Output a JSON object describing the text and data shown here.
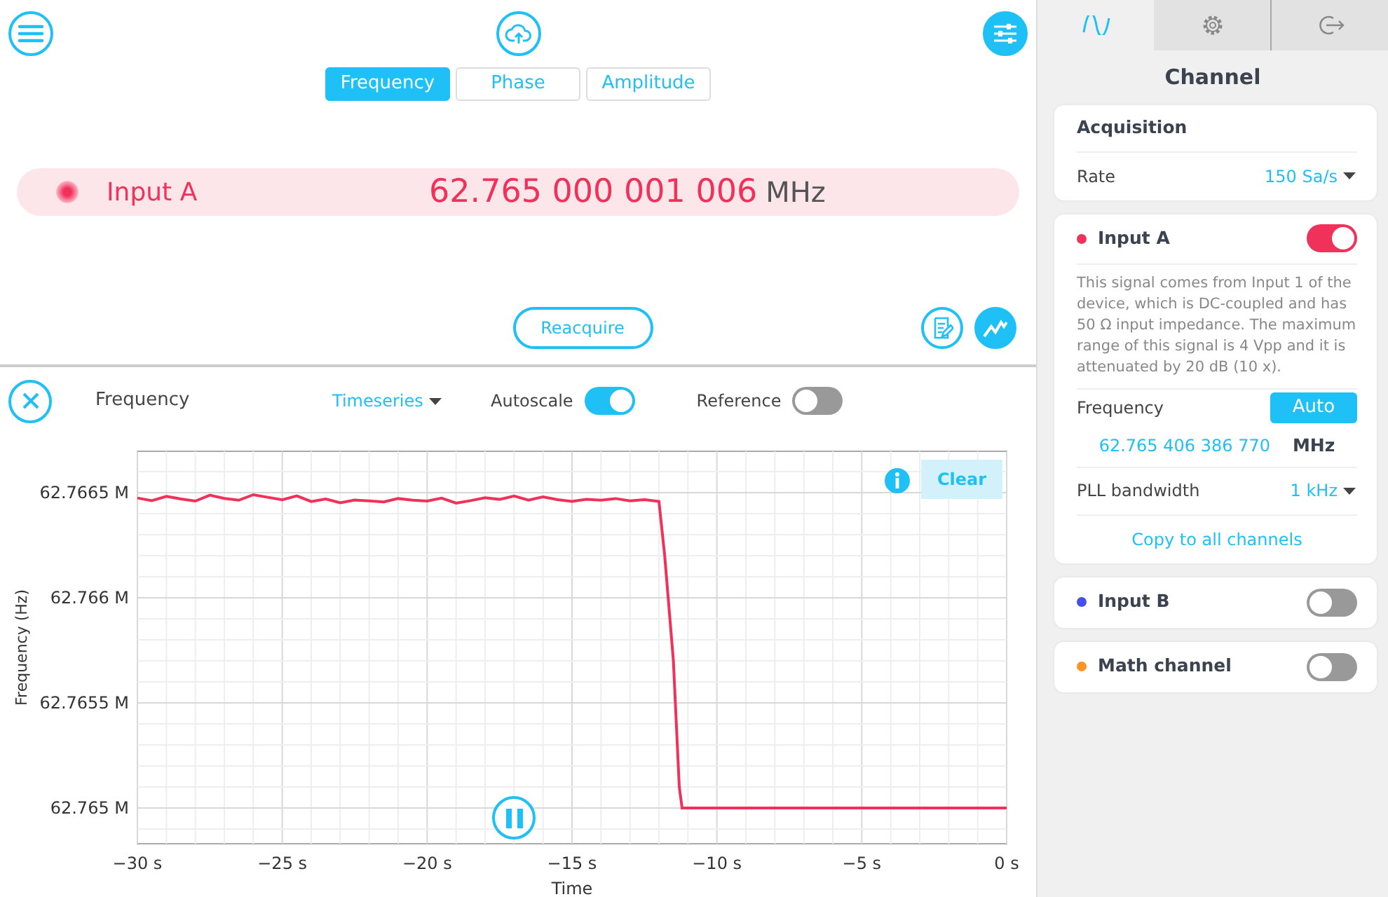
{
  "view_tabs": [
    {
      "label": "Frequency",
      "selected": true
    },
    {
      "label": "Phase",
      "selected": false
    },
    {
      "label": "Amplitude",
      "selected": false
    }
  ],
  "reading": {
    "channel": "Input A",
    "value": "62.765 000 001 006",
    "unit": "MHz"
  },
  "reacquire": "Reacquire",
  "plot_toolbar": {
    "title": "Frequency",
    "mode": "Timeseries",
    "autoscale": {
      "label": "Autoscale",
      "on": true
    },
    "reference": {
      "label": "Reference",
      "on": false
    }
  },
  "plot": {
    "clear": "Clear",
    "chart_data": {
      "type": "line",
      "grid": true,
      "xlabel": "Time",
      "ylabel": "Frequency (Hz)",
      "xlim": [
        -30,
        0
      ],
      "ylim": [
        62764830,
        62766697
      ],
      "xticks": [
        {
          "value": -30,
          "label": "−30 s"
        },
        {
          "value": -25,
          "label": "−25 s"
        },
        {
          "value": -20,
          "label": "−20 s"
        },
        {
          "value": -15,
          "label": "−15 s"
        },
        {
          "value": -10,
          "label": "−10 s"
        },
        {
          "value": -5,
          "label": "−5 s"
        },
        {
          "value": 0,
          "label": "0 s"
        }
      ],
      "yticks": [
        {
          "value": 62765000,
          "label": "62.765 M"
        },
        {
          "value": 62765500,
          "label": "62.7655 M"
        },
        {
          "value": 62766000,
          "label": "62.766 M"
        },
        {
          "value": 62766500,
          "label": "62.7665 M"
        }
      ],
      "x": [
        -30,
        -29.5,
        -29,
        -28.5,
        -28,
        -27.5,
        -27,
        -26.5,
        -26,
        -25.5,
        -25,
        -24.5,
        -24,
        -23.5,
        -23,
        -22.5,
        -22,
        -21.5,
        -21,
        -20.5,
        -20,
        -19.5,
        -19,
        -18.5,
        -18,
        -17.5,
        -17,
        -16.5,
        -16,
        -15.5,
        -15,
        -14.5,
        -14,
        -13.5,
        -13,
        -12.5,
        -12,
        -11.8,
        -11.5,
        -11.3,
        -11.2,
        0
      ],
      "series": [
        {
          "color": "#f0325a",
          "values": [
            62766475,
            62766462,
            62766482,
            62766470,
            62766460,
            62766488,
            62766473,
            62766464,
            62766490,
            62766478,
            62766466,
            62766485,
            62766458,
            62766470,
            62766452,
            62766465,
            62766461,
            62766456,
            62766472,
            62766464,
            62766460,
            62766474,
            62766450,
            62766462,
            62766476,
            62766468,
            62766484,
            62766465,
            62766480,
            62766467,
            62766459,
            62766469,
            62766464,
            62766472,
            62766461,
            62766467,
            62766458,
            62766200,
            62765700,
            62765100,
            62765000,
            62765000
          ]
        }
      ]
    }
  },
  "sidebar": {
    "tabs": [
      {
        "kind": "wave",
        "selected": true
      },
      {
        "kind": "gear",
        "selected": false
      },
      {
        "kind": "exit",
        "selected": false
      }
    ],
    "title": "Channel",
    "acquisition": {
      "title": "Acquisition",
      "rate_label": "Rate",
      "rate": "150 Sa/s"
    },
    "channels": [
      {
        "name": "Input A",
        "color": "#f0325a",
        "on": true,
        "description": "This signal comes from Input 1 of the device, which is DC-coupled and has 50 Ω input impedance. The maximum range of this signal is 4 Vpp and it is attenuated by 20 dB (10 x).",
        "frequency_label": "Frequency",
        "mode": "Auto",
        "frequency": "62.765 406 386 770",
        "unit": "MHz",
        "pll_label": "PLL bandwidth",
        "pll": "1 kHz",
        "copy": "Copy to all channels"
      },
      {
        "name": "Input B",
        "color": "#4450e8",
        "on": false
      },
      {
        "name": "Math channel",
        "color": "#ff9424",
        "on": false
      }
    ]
  }
}
